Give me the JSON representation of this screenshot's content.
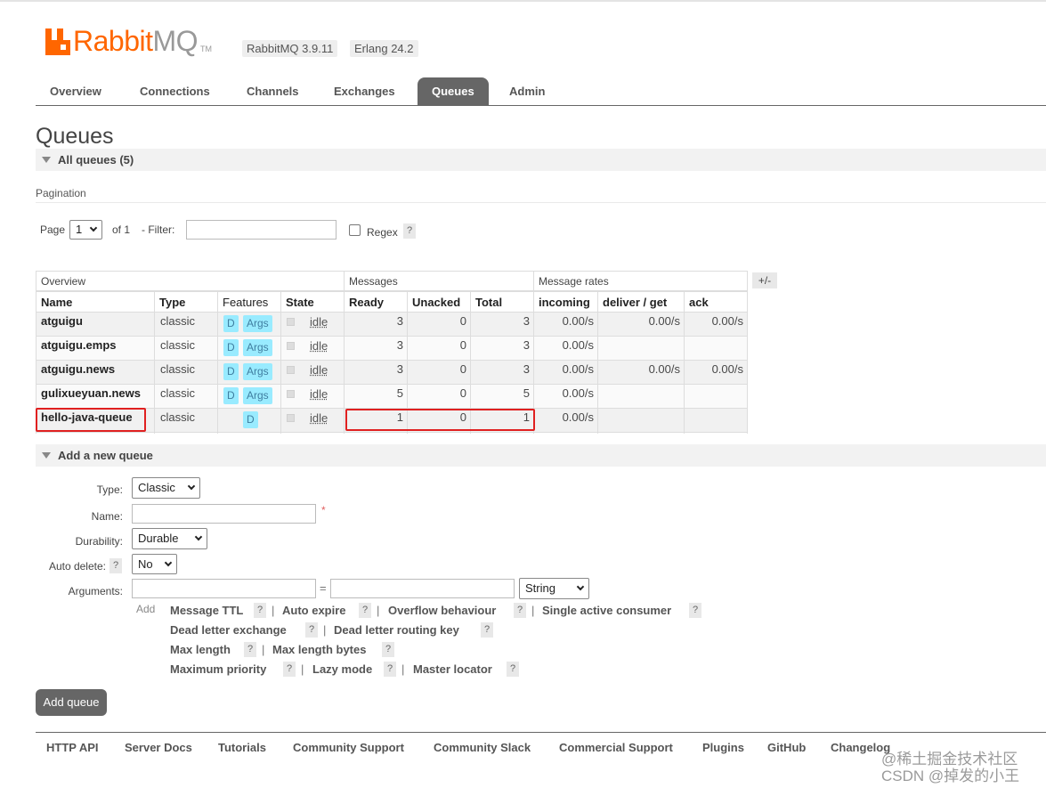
{
  "header": {
    "logo_rabbit": "Rabbit",
    "logo_mq": "MQ",
    "logo_tm": "TM",
    "version": "RabbitMQ 3.9.11",
    "erlang": "Erlang 24.2"
  },
  "tabs": [
    "Overview",
    "Connections",
    "Channels",
    "Exchanges",
    "Queues",
    "Admin"
  ],
  "active_tab": "Queues",
  "page_title": "Queues",
  "all_queues": {
    "label": "All queues (5)"
  },
  "pagination": {
    "section_label": "Pagination",
    "page_label": "Page",
    "page_value": "1",
    "of_label": "of 1",
    "filter_label": "- Filter:",
    "filter_value": "",
    "regex_label": "Regex",
    "help": "?"
  },
  "table": {
    "group_headers": {
      "overview": "Overview",
      "messages": "Messages",
      "rates": "Message rates"
    },
    "plus_minus": "+/-",
    "columns": {
      "name": "Name",
      "type": "Type",
      "features": "Features",
      "state": "State",
      "ready": "Ready",
      "unacked": "Unacked",
      "total": "Total",
      "incoming": "incoming",
      "deliver_get": "deliver / get",
      "ack": "ack"
    },
    "rows": [
      {
        "name": "atguigu",
        "type": "classic",
        "feat_d": "D",
        "feat_args": "Args",
        "state": "idle",
        "ready": "3",
        "unacked": "0",
        "total": "3",
        "incoming": "0.00/s",
        "deliver_get": "0.00/s",
        "ack": "0.00/s"
      },
      {
        "name": "atguigu.emps",
        "type": "classic",
        "feat_d": "D",
        "feat_args": "Args",
        "state": "idle",
        "ready": "3",
        "unacked": "0",
        "total": "3",
        "incoming": "0.00/s",
        "deliver_get": "",
        "ack": ""
      },
      {
        "name": "atguigu.news",
        "type": "classic",
        "feat_d": "D",
        "feat_args": "Args",
        "state": "idle",
        "ready": "3",
        "unacked": "0",
        "total": "3",
        "incoming": "0.00/s",
        "deliver_get": "0.00/s",
        "ack": "0.00/s"
      },
      {
        "name": "gulixueyuan.news",
        "type": "classic",
        "feat_d": "D",
        "feat_args": "Args",
        "state": "idle",
        "ready": "5",
        "unacked": "0",
        "total": "5",
        "incoming": "0.00/s",
        "deliver_get": "",
        "ack": ""
      },
      {
        "name": "hello-java-queue",
        "type": "classic",
        "feat_d": "D",
        "feat_args": "",
        "state": "idle",
        "ready": "1",
        "unacked": "0",
        "total": "1",
        "incoming": "0.00/s",
        "deliver_get": "",
        "ack": ""
      }
    ]
  },
  "add_queue": {
    "section_label": "Add a new queue",
    "type_label": "Type:",
    "type_value": "Classic",
    "name_label": "Name:",
    "name_value": "",
    "required_mark": "*",
    "durability_label": "Durability:",
    "durability_value": "Durable",
    "auto_delete_label": "Auto delete:",
    "auto_delete_value": "No",
    "arguments_label": "Arguments:",
    "equals": "=",
    "arg_type_value": "String",
    "add_label": "Add",
    "arg_options": [
      "Message TTL",
      "Auto expire",
      "Overflow behaviour",
      "Single active consumer",
      "Dead letter exchange",
      "Dead letter routing key",
      "Max length",
      "Max length bytes",
      "Maximum priority",
      "Lazy mode",
      "Master locator"
    ],
    "separator": "|",
    "button_label": "Add queue"
  },
  "footer": [
    "HTTP API",
    "Server Docs",
    "Tutorials",
    "Community Support",
    "Community Slack",
    "Commercial Support",
    "Plugins",
    "GitHub",
    "Changelog"
  ],
  "watermarks": {
    "line1": "@稀土掘金技术社区",
    "line2": "CSDN @掉发的小王"
  },
  "colors": {
    "brand": "#ff6600",
    "highlight": "#e02020",
    "badge": "#99ebff"
  }
}
